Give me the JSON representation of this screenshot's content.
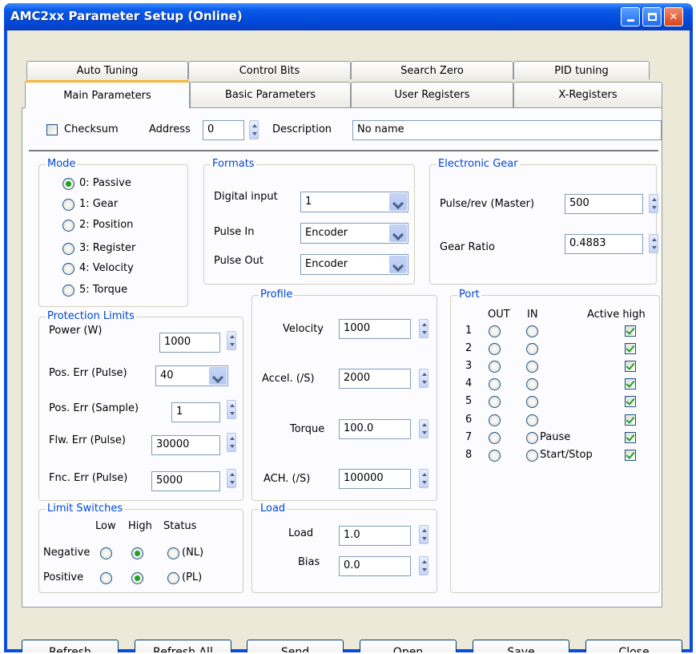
{
  "window": {
    "title": "AMC2xx Parameter Setup (Online)"
  },
  "tabs_back": [
    "Auto Tuning",
    "Control Bits",
    "Search Zero",
    "PID tuning"
  ],
  "tabs_front": [
    "Main Parameters",
    "Basic Parameters",
    "User Registers",
    "X-Registers"
  ],
  "top": {
    "checksum_label": "Checksum",
    "address_label": "Address",
    "address_value": "0",
    "description_label": "Description",
    "description_value": "No name"
  },
  "mode": {
    "title": "Mode",
    "options": [
      "0: Passive",
      "1: Gear",
      "2: Position",
      "3: Register",
      "4: Velocity",
      "5: Torque"
    ],
    "selected": 0
  },
  "formats": {
    "title": "Formats",
    "digital_input_label": "Digital input",
    "digital_input_value": "1",
    "pulse_in_label": "Pulse In",
    "pulse_in_value": "Encoder",
    "pulse_out_label": "Pulse Out",
    "pulse_out_value": "Encoder"
  },
  "gear": {
    "title": "Electronic Gear",
    "pulse_label": "Pulse/rev (Master)",
    "pulse_value": "500",
    "ratio_label": "Gear Ratio",
    "ratio_value": "0.4883"
  },
  "protection": {
    "title": "Protection Limits",
    "power_label": "Power (W)",
    "power_value": "1000",
    "pos_err_pulse_label": "Pos. Err (Pulse)",
    "pos_err_pulse_value": "40",
    "pos_err_sample_label": "Pos. Err (Sample)",
    "pos_err_sample_value": "1",
    "flw_err_label": "Flw. Err (Pulse)",
    "flw_err_value": "30000",
    "fnc_err_label": "Fnc. Err (Pulse)",
    "fnc_err_value": "5000"
  },
  "profile": {
    "title": "Profile",
    "velocity_label": "Velocity",
    "velocity_value": "1000",
    "accel_label": "Accel. (/S)",
    "accel_value": "2000",
    "torque_label": "Torque",
    "torque_value": "100.0",
    "ach_label": "ACH. (/S)",
    "ach_value": "100000"
  },
  "limit": {
    "title": "Limit Switches",
    "low": "Low",
    "high": "High",
    "status": "Status",
    "negative": "Negative",
    "positive": "Positive",
    "nl": "(NL)",
    "pl": "(PL)"
  },
  "load": {
    "title": "Load",
    "load_label": "Load",
    "load_value": "1.0",
    "bias_label": "Bias",
    "bias_value": "0.0"
  },
  "port": {
    "title": "Port",
    "out": "OUT",
    "in": "IN",
    "active_high": "Active high",
    "rows": [
      "1",
      "2",
      "3",
      "4",
      "5",
      "6",
      "7",
      "8"
    ],
    "pause": "Pause",
    "start_stop": "Start/Stop"
  },
  "buttons": [
    "Refresh",
    "Refresh All",
    "Send",
    "Open",
    "Save",
    "Close"
  ],
  "colors": {
    "title_bar": "#0054e3",
    "group_label": "#0046d5",
    "tab_highlight": "#f4b73a",
    "check": "#21a121"
  }
}
